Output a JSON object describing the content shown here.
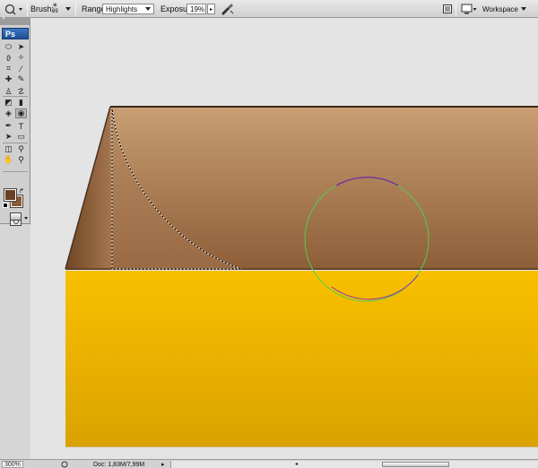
{
  "options_bar": {
    "brush_label": "Brush:",
    "brush_size": "99",
    "range_label": "Range:",
    "range_value": "Highlights",
    "exposure_label": "Exposure:",
    "exposure_value": "19%",
    "workspace_label": "Workspace"
  },
  "tools_panel": {
    "logo": "Ps",
    "tools": [
      {
        "name": "marquee-tool-icon",
        "glyph": "⬭"
      },
      {
        "name": "move-tool-icon",
        "glyph": "➤"
      },
      {
        "name": "lasso-tool-icon",
        "glyph": "ϑ"
      },
      {
        "name": "magic-wand-tool-icon",
        "glyph": "✧"
      },
      {
        "name": "crop-tool-icon",
        "glyph": "⌗"
      },
      {
        "name": "eyedropper-tool-icon",
        "glyph": "⁄"
      },
      {
        "name": "healing-brush-tool-icon",
        "glyph": "✚"
      },
      {
        "name": "brush-tool-icon",
        "glyph": "✎"
      },
      {
        "name": "clone-stamp-tool-icon",
        "glyph": "♙"
      },
      {
        "name": "history-brush-tool-icon",
        "glyph": "☡"
      },
      {
        "name": "eraser-tool-icon",
        "glyph": "◩"
      },
      {
        "name": "gradient-tool-icon",
        "glyph": "▮"
      },
      {
        "name": "blur-tool-icon",
        "glyph": "◈"
      },
      {
        "name": "dodge-tool-icon",
        "glyph": "◉"
      },
      {
        "name": "pen-tool-icon",
        "glyph": "✒"
      },
      {
        "name": "type-tool-icon",
        "glyph": "T"
      },
      {
        "name": "path-selection-tool-icon",
        "glyph": "➤"
      },
      {
        "name": "shape-tool-icon",
        "glyph": "▭"
      },
      {
        "name": "3d-tool-icon",
        "glyph": "◫"
      },
      {
        "name": "3d-camera-tool-icon",
        "glyph": "⚲"
      },
      {
        "name": "hand-tool-icon",
        "glyph": "✋"
      },
      {
        "name": "zoom-tool-icon",
        "glyph": "⚲"
      }
    ],
    "active_tool": "dodge-tool-icon",
    "foreground_color": "#6a4226",
    "background_color": "#8a5a33"
  },
  "status_bar": {
    "zoom": "300%",
    "doc_info": "Doc: 1,83M/7,99M"
  },
  "colors": {
    "box_lid_top": "#c89c71",
    "box_lid_bottom": "#8f603a",
    "box_body_top": "#f9c000",
    "box_body_bottom": "#dca300",
    "brush_cursor_green": "#4fd04f",
    "brush_cursor_purple": "#8a2fb0"
  }
}
